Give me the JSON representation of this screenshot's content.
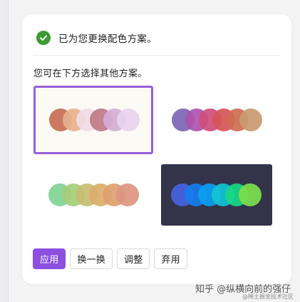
{
  "status": {
    "message": "已为您更换配色方案。",
    "icon": "check-circle-icon",
    "icon_color": "#3e9a32"
  },
  "hint": "您可在下方选择其他方案。",
  "schemes": [
    {
      "selected": true,
      "background": "#fbfaf5",
      "colors": [
        "#c96d52",
        "#e8b18c",
        "#f0dce3",
        "#c07a86",
        "#d6acd6",
        "#e8d3ee"
      ]
    },
    {
      "selected": false,
      "background": "#ffffff",
      "colors": [
        "#7b65b6",
        "#b051b1",
        "#cd4d79",
        "#d45558",
        "#ce6d4f",
        "#c99a70"
      ]
    },
    {
      "selected": false,
      "background": "#ffffff",
      "colors": [
        "#7fd493",
        "#a5ce79",
        "#c7be6f",
        "#dbae6b",
        "#dfa070",
        "#dc9580"
      ]
    },
    {
      "selected": false,
      "background": "#33344a",
      "colors": [
        "#4762e0",
        "#177cee",
        "#0aa0ef",
        "#10c4d6",
        "#18d886",
        "#7ddf4c"
      ]
    }
  ],
  "buttons": {
    "apply": "应用",
    "swap": "换一换",
    "adjust": "调整",
    "discard": "弃用"
  },
  "accent": "#8c4fe0",
  "watermark": {
    "main": "知乎 @纵横向前的强仔",
    "sub": "@稀土掘金技术社区"
  }
}
